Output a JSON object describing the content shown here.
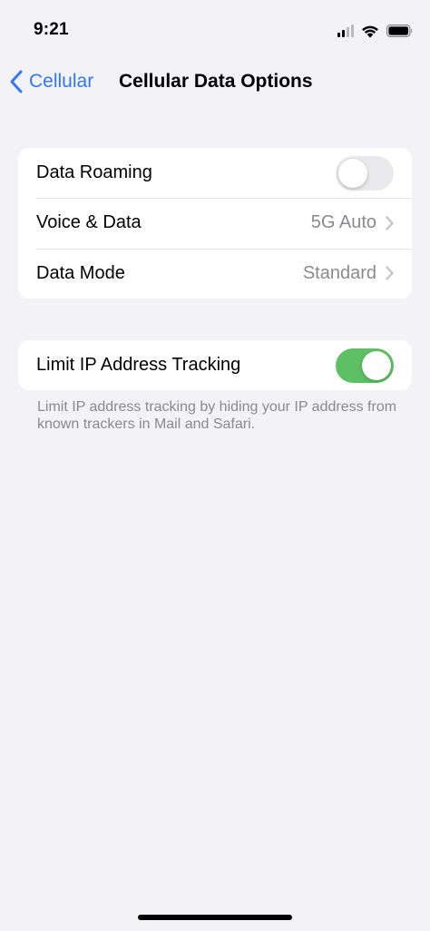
{
  "status_bar": {
    "time": "9:21",
    "signal_bars_active": 2,
    "signal_bars_total": 4
  },
  "nav": {
    "back_label": "Cellular",
    "title": "Cellular Data Options"
  },
  "group_1": {
    "rows": [
      {
        "label": "Data Roaming",
        "type": "toggle",
        "on": false
      },
      {
        "label": "Voice & Data",
        "type": "disclosure",
        "value": "5G Auto"
      },
      {
        "label": "Data Mode",
        "type": "disclosure",
        "value": "Standard"
      }
    ]
  },
  "group_2": {
    "rows": [
      {
        "label": "Limit IP Address Tracking",
        "type": "toggle",
        "on": true
      }
    ],
    "footnote": "Limit IP address tracking by hiding your IP address from known trackers in Mail and Safari."
  },
  "colors": {
    "accent": "#3478F6",
    "toggle_on": "#5DC065",
    "toggle_off": "#E9E9EB",
    "background": "#F2F2F7",
    "secondary_text": "#8A8A8E"
  }
}
